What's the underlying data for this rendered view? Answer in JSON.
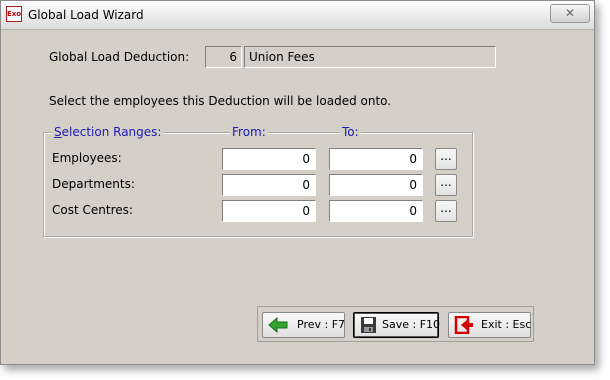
{
  "window": {
    "title": "Global Load Wizard",
    "icon_text": "Exo",
    "close_glyph": "✕"
  },
  "deduction": {
    "label": "Global Load Deduction:",
    "code": "6",
    "name": "Union Fees"
  },
  "instruction": "Select the employees this Deduction will be loaded onto.",
  "selection": {
    "legend_underlined": "S",
    "legend_rest": "election Ranges:",
    "from_header": "From:",
    "to_header": "To:",
    "rows": [
      {
        "label": "Employees:",
        "from": "0",
        "to": "0",
        "lookup": "..."
      },
      {
        "label": "Departments:",
        "from": "0",
        "to": "0",
        "lookup": "..."
      },
      {
        "label": "Cost Centres:",
        "from": "0",
        "to": "0",
        "lookup": "..."
      }
    ]
  },
  "buttons": {
    "prev": "Prev : F7",
    "save": "Save : F10",
    "exit": "Exit : Esc"
  },
  "colors": {
    "dialog_bg": "#d4d0c8",
    "legend_text": "#1c1cb4",
    "prev_arrow": "#2fa52f",
    "exit_icon": "#d40000"
  },
  "icons": [
    "exo-app-icon",
    "close-icon",
    "prev-arrow-icon",
    "save-disk-icon",
    "exit-door-icon"
  ]
}
